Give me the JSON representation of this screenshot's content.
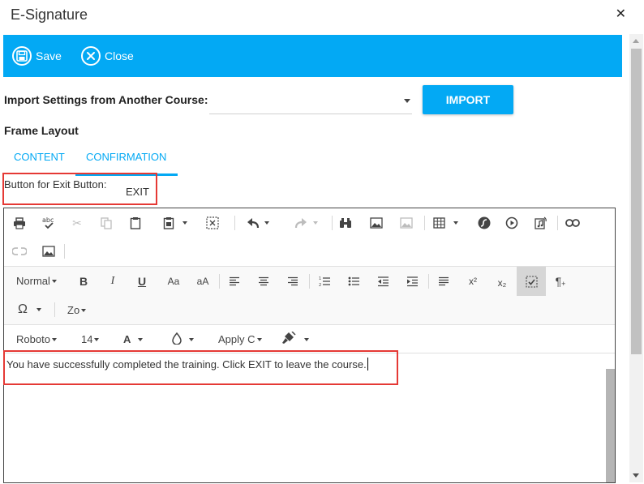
{
  "window": {
    "title": "E-Signature",
    "close_glyph": "✕"
  },
  "toolbar": {
    "save_label": "Save",
    "close_label": "Close"
  },
  "import": {
    "label": "Import Settings from Another Course:",
    "selected": "",
    "button_label": "IMPORT"
  },
  "frame_layout": {
    "label": "Frame Layout"
  },
  "tabs": [
    {
      "label": "CONTENT",
      "active": false
    },
    {
      "label": "CONFIRMATION",
      "active": true
    }
  ],
  "exit_button": {
    "label": "Button for Exit Button:",
    "value": "EXIT"
  },
  "editor": {
    "format_dropdown": "Normal",
    "zoom_dropdown": "Zo",
    "font_dropdown": "Roboto",
    "size_dropdown": "14",
    "apply_dropdown": "Apply C",
    "text_color_glyph": "A",
    "content": "You have successfully completed the training.  Click EXIT to leave the course."
  },
  "colors": {
    "accent": "#03a9f4",
    "highlight": "#e53935"
  },
  "icons": [
    "save-icon",
    "close-circle-icon",
    "print-icon",
    "spellcheck-icon",
    "cut-icon",
    "copy-icon",
    "paste-icon",
    "paste-word-icon",
    "select-all-icon",
    "undo-icon",
    "redo-icon",
    "find-icon",
    "image-icon",
    "image-map-icon",
    "table-icon",
    "flash-icon",
    "video-icon",
    "audio-icon",
    "link-icon",
    "unlink-icon",
    "insert-image-icon",
    "bold-icon",
    "italic-icon",
    "underline-icon",
    "font-case-upper-icon",
    "font-case-lower-icon",
    "align-left-icon",
    "align-center-icon",
    "align-right-icon",
    "ordered-list-icon",
    "unordered-list-icon",
    "outdent-icon",
    "indent-icon",
    "justify-icon",
    "superscript-icon",
    "subscript-icon",
    "clear-format-icon",
    "paragraph-icon",
    "omega-icon",
    "fill-color-icon",
    "brush-icon"
  ]
}
